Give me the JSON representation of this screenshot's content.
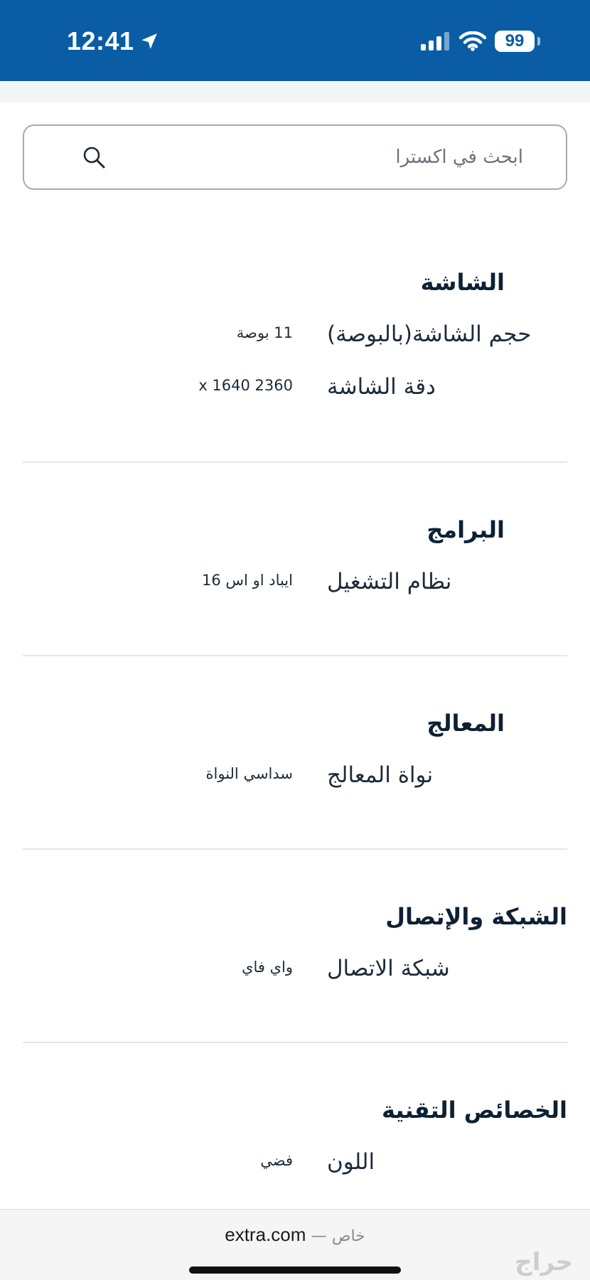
{
  "status_bar": {
    "time": "12:41",
    "battery": "99",
    "icons": [
      "location-arrow-icon",
      "cellular-signal-icon",
      "wifi-icon",
      "battery-icon"
    ],
    "background_color": "#0a5da5"
  },
  "search": {
    "placeholder": "ابحث في اكسترا",
    "value": "",
    "icon": "search-icon"
  },
  "sections": [
    {
      "title": "الشاشة",
      "rows": [
        {
          "label": "حجم الشاشة(بالبوصة)",
          "value": "11 بوصة"
        },
        {
          "label": "دقة الشاشة",
          "value": "x 1640 2360"
        }
      ]
    },
    {
      "title": "البرامج",
      "rows": [
        {
          "label": "نظام التشغيل",
          "value": "ايباد او اس 16"
        }
      ]
    },
    {
      "title": "المعالج",
      "rows": [
        {
          "label": "نواة المعالج",
          "value": "سداسي النواة"
        }
      ]
    },
    {
      "title": "الشبكة والإتصال",
      "rows": [
        {
          "label": "شبكة الاتصال",
          "value": "واي فاي"
        }
      ]
    },
    {
      "title": "الخصائص التقنية",
      "rows": [
        {
          "label": "اللون",
          "value": "فضي"
        }
      ]
    }
  ],
  "url_bar": {
    "domain": "extra.com",
    "separator": "—",
    "secure_label": "خاص"
  },
  "watermark": "حراج"
}
